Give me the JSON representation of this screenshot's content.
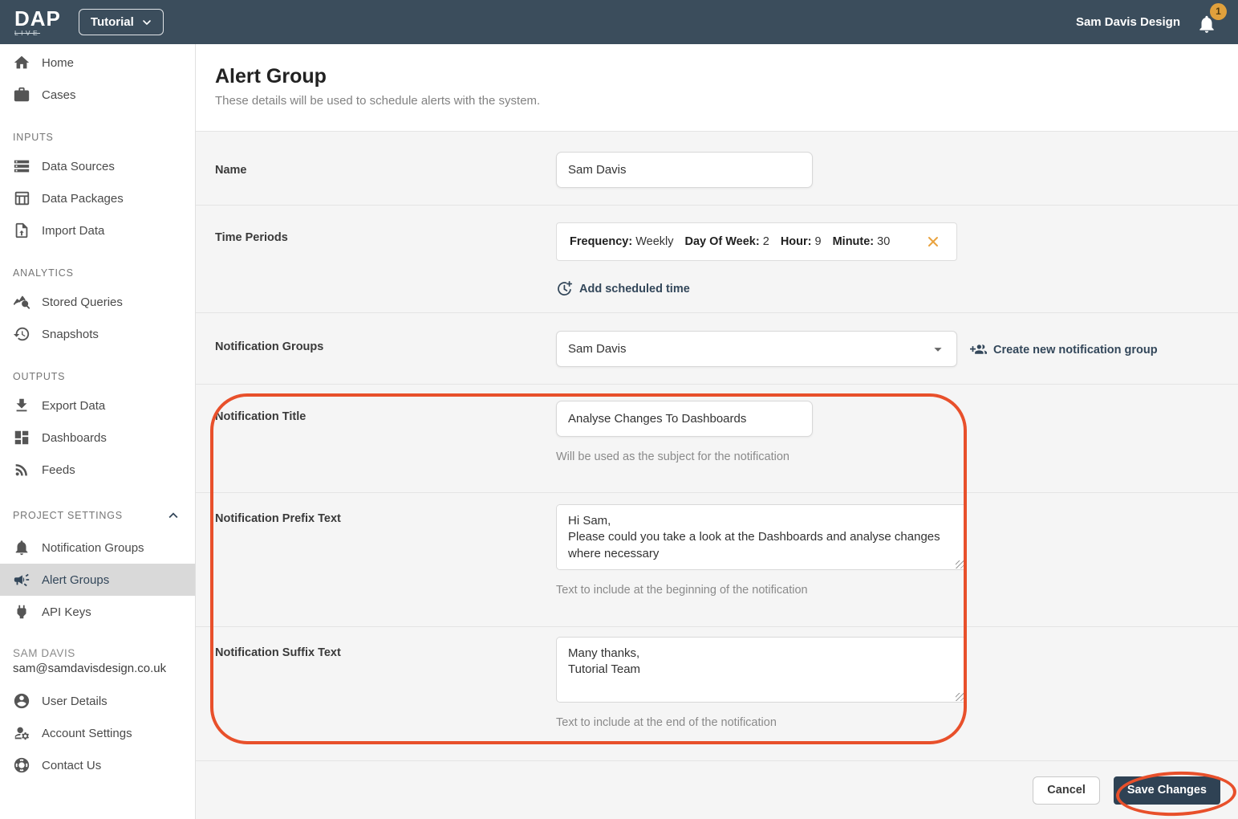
{
  "header": {
    "logo_main": "DAP",
    "logo_sub": "LIVE",
    "project_name": "Tutorial",
    "account_name": "Sam Davis Design",
    "notification_count": "1"
  },
  "sidebar": {
    "top_items": [
      {
        "label": "Home"
      },
      {
        "label": "Cases"
      }
    ],
    "sections": [
      {
        "title": "INPUTS",
        "items": [
          {
            "label": "Data Sources"
          },
          {
            "label": "Data Packages"
          },
          {
            "label": "Import Data"
          }
        ]
      },
      {
        "title": "ANALYTICS",
        "items": [
          {
            "label": "Stored Queries"
          },
          {
            "label": "Snapshots"
          }
        ]
      },
      {
        "title": "OUTPUTS",
        "items": [
          {
            "label": "Export Data"
          },
          {
            "label": "Dashboards"
          },
          {
            "label": "Feeds"
          }
        ]
      },
      {
        "title": "PROJECT SETTINGS",
        "items": [
          {
            "label": "Notification Groups"
          },
          {
            "label": "Alert Groups"
          },
          {
            "label": "API Keys"
          }
        ]
      }
    ],
    "user": {
      "name": "SAM DAVIS",
      "email": "sam@samdavisdesign.co.uk",
      "items": [
        {
          "label": "User Details"
        },
        {
          "label": "Account Settings"
        },
        {
          "label": "Contact Us"
        }
      ]
    }
  },
  "main": {
    "title": "Alert Group",
    "subtitle": "These details will be used to schedule alerts with the system.",
    "name_field": {
      "label": "Name",
      "value": "Sam Davis"
    },
    "time_periods": {
      "label": "Time Periods",
      "schedule": {
        "frequency_label": "Frequency:",
        "frequency_value": "Weekly",
        "day_label": "Day Of Week:",
        "day_value": "2",
        "hour_label": "Hour:",
        "hour_value": "9",
        "minute_label": "Minute:",
        "minute_value": "30"
      },
      "add_button": "Add scheduled time"
    },
    "notification_groups": {
      "label": "Notification Groups",
      "selected_value": "Sam Davis",
      "create_button": "Create new notification group"
    },
    "notification_title": {
      "label": "Notification Title",
      "value": "Analyse Changes To Dashboards",
      "hint": "Will be used as the subject for the notification"
    },
    "notification_prefix": {
      "label": "Notification Prefix Text",
      "value": "Hi Sam,\nPlease could you take a look at the Dashboards and analyse changes where necessary",
      "hint": "Text to include at the beginning of the notification"
    },
    "notification_suffix": {
      "label": "Notification Suffix Text",
      "value": "Many thanks,\nTutorial Team",
      "hint": "Text to include at the end of the notification"
    },
    "footer": {
      "cancel_button": "Cancel",
      "save_button": "Save Changes"
    }
  },
  "colors": {
    "header_bg": "#3b4d5c",
    "accent_navy": "#33475a",
    "save_button_bg": "#2f4254",
    "annotation_orange": "#e8502b",
    "amber": "#e9a23e",
    "active_item_bg": "#d9d9d9",
    "form_bg": "#f5f5f5"
  }
}
